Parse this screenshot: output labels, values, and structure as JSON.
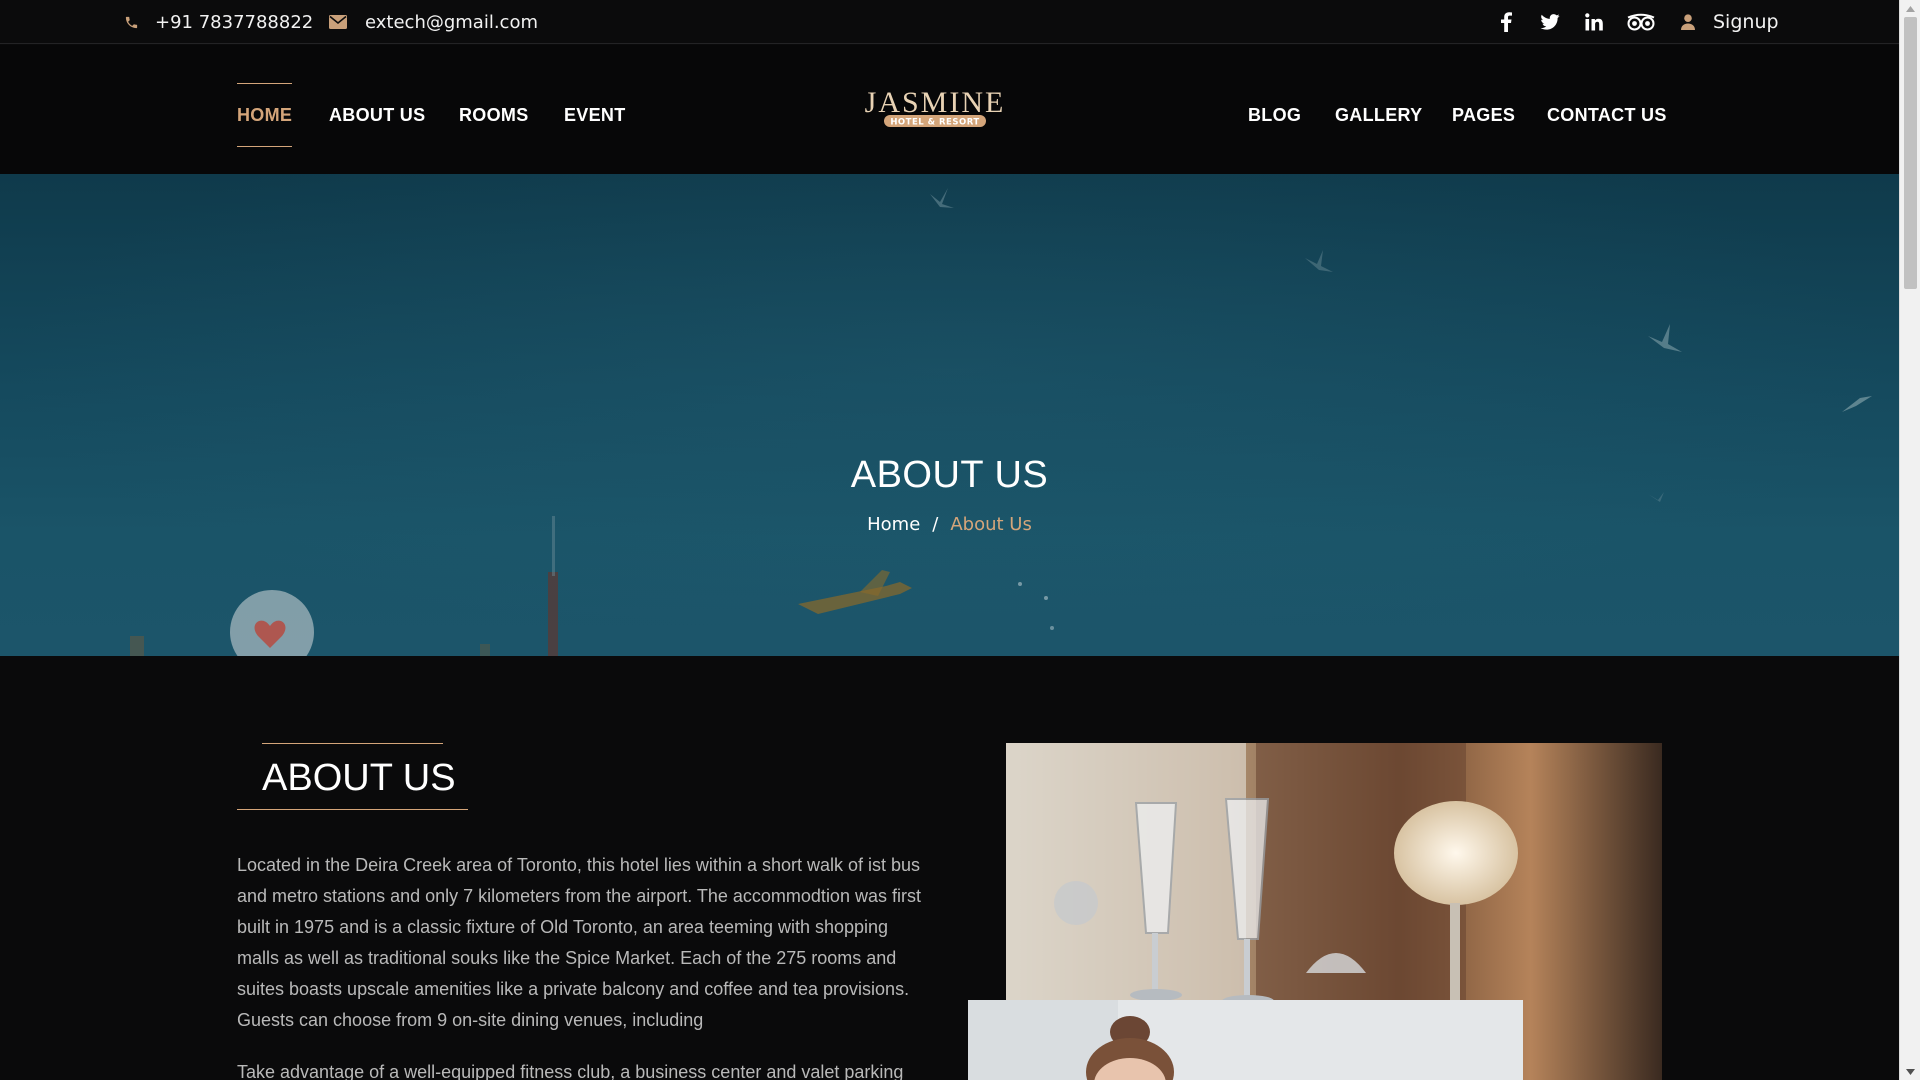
{
  "topbar": {
    "phone": "+91 7837788822",
    "email": "extech@gmail.com",
    "social_icons": [
      "facebook-icon",
      "twitter-icon",
      "linkedin-icon",
      "tripadvisor-icon"
    ],
    "signup_label": "Signup"
  },
  "nav": {
    "left_links": [
      "HOME",
      "ABOUT US",
      "ROOMS",
      "EVENT"
    ],
    "right_links": [
      "BLOG",
      "GALLERY",
      "PAGES",
      "CONTACT US"
    ],
    "active": "HOME",
    "logo_text": "JASMINE",
    "logo_subtext": "HOTEL & RESORT"
  },
  "hero": {
    "title": "ABOUT US",
    "breadcrumb_home": "Home",
    "breadcrumb_separator": "/",
    "breadcrumb_current": "About Us"
  },
  "about": {
    "heading": "ABOUT US",
    "paragraph1": "Located in the Deira Creek area of Toronto, this hotel lies within a short walk of ist bus and metro stations and only 7 kilometers from the airport. The accommodtion was first built in 1975 and is a classic fixture of Old Toronto, an area teeming with shopping malls as well as traditional souks like the Spice Market. Each of the 275 rooms and suites boasts upscale amenities like a private balcony and coffee and tea provisions. Guests can choose from 9 on-site dining venues, including",
    "paragraph2": "Take advantage of a well-equipped fitness club, a business center and valet parking"
  },
  "colors": {
    "accent": "#d4a57a",
    "background": "#0a0a0b",
    "hero_teal": "#154a5e",
    "body_text": "#b9b9b9"
  }
}
